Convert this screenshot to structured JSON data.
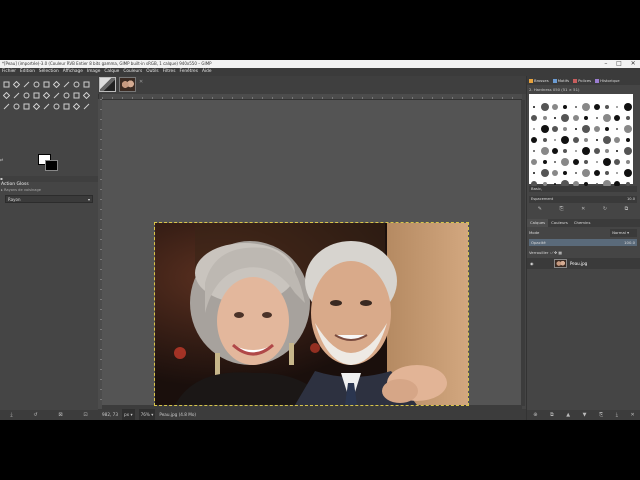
{
  "window": {
    "title": "*[Peau] (importée)-3.0 (Couleur RVB Entier 8 bits gamma, GIMP built-in sRGB, 1 calque) 940x550 – GIMP",
    "controls": [
      "–",
      "□",
      "✕"
    ]
  },
  "menu": [
    "Fichier",
    "Édition",
    "Sélection",
    "Affichage",
    "Image",
    "Calque",
    "Couleurs",
    "Outils",
    "Filtres",
    "Fenêtres",
    "Aide"
  ],
  "toolbox": {
    "tools": [
      "move-icon",
      "rect-select-icon",
      "lasso-icon",
      "fuzzy-select-icon",
      "crop-icon",
      "rotate-icon",
      "warp-icon",
      "perspective-icon",
      "flip-icon",
      "zoom-icon",
      "measure-icon",
      "text-icon",
      "paths-icon",
      "color-picker-icon",
      "bucket-fill-icon",
      "gradient-icon",
      "pencil-icon",
      "paintbrush-icon",
      "eraser-icon",
      "airbrush-icon",
      "ink-icon",
      "clone-icon",
      "heal-icon",
      "smudge-icon",
      "blur-icon",
      "dodge-icon",
      "mypaint-icon"
    ],
    "swap_glyph": "⇄"
  },
  "tool_options": {
    "header": "▪",
    "title": "Action Gloss",
    "subtitle": "▸ Rayons de voisinage",
    "field": "Rayon",
    "field_arrow": "▾"
  },
  "left_bottom_icons": [
    "⤓",
    "↺",
    "⊠",
    "⊡"
  ],
  "image_tabs": {
    "close": "✕"
  },
  "status": {
    "coords": "982, 73",
    "unit": "px ▾",
    "zoom": "76% ▾",
    "file": "Peau.jpg (4.8 Mo)"
  },
  "dock": {
    "tabs": [
      "Brosses",
      "Motifs",
      "Polices",
      "Historique"
    ],
    "tab_colors": [
      "#e8a33d",
      "#6b9bd2",
      "#c85d5d",
      "#9a7dd1"
    ],
    "brush_name": "2. Hardness 050 (51 × 51)",
    "brush_tag": "Basic,",
    "spacing_label": "Espacement",
    "spacing_value": "10.0",
    "tool_icons": [
      "✎",
      "⎘",
      "✕",
      "↻",
      "⧉"
    ],
    "layer_tabs": [
      "Calques",
      "Couleurs",
      "Chemins"
    ],
    "mode_label": "Mode",
    "mode_value": "Normal ▾",
    "opacity_label": "Opacité",
    "opacity_value": "100.0",
    "lock_label": "Verrouiller :",
    "lock_icons": "⁄ ✥ ▦",
    "layer_eye": "◉",
    "layer_name": "Peau.jpg",
    "bottom_icons": [
      "⊕",
      "⧉",
      "▲",
      "▼",
      "⎘",
      "⤓",
      "✕"
    ]
  }
}
